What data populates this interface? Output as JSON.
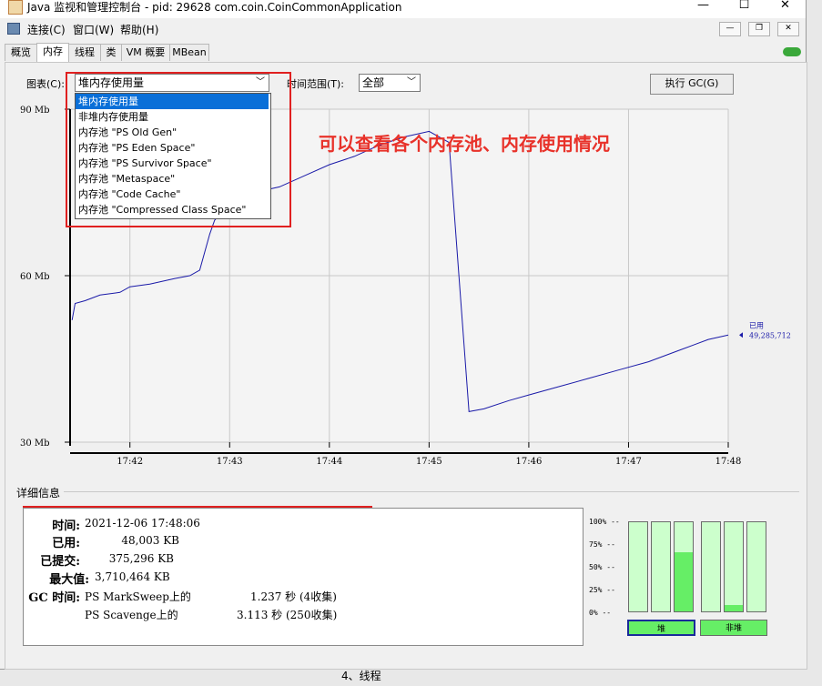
{
  "window": {
    "title": "Java 监视和管理控制台 - pid: 29628 com.coin.CoinCommonApplication",
    "minimize_icon": "minimize-icon",
    "maximize_icon": "maximize-icon",
    "close_icon": "close-icon"
  },
  "menu": [
    "连接(C)",
    "窗口(W)",
    "帮助(H)"
  ],
  "tabs": [
    "概览",
    "内存",
    "线程",
    "类",
    "VM 概要",
    "MBean"
  ],
  "active_tab": "内存",
  "controls": {
    "chart_label": "图表(C):",
    "chart_value": "堆内存使用量",
    "range_label": "时间范围(T):",
    "range_value": "全部",
    "gc_button": "执行 GC(G)"
  },
  "dropdown_options": [
    "堆内存使用量",
    "非堆内存使用量",
    "内存池 \"PS Old Gen\"",
    "内存池 \"PS Eden Space\"",
    "内存池 \"PS Survivor Space\"",
    "内存池 \"Metaspace\"",
    "内存池 \"Code Cache\"",
    "内存池 \"Compressed Class Space\""
  ],
  "annotation": "可以查看各个内存池、内存使用情况",
  "chart_data": {
    "type": "line",
    "y_ticks": [
      "90 Mb",
      "60 Mb",
      "30 Mb"
    ],
    "y_tick_values": [
      90,
      60,
      30
    ],
    "ylim": [
      30,
      90
    ],
    "x_ticks": [
      "17:42",
      "17:43",
      "17:44",
      "17:45",
      "17:46",
      "17:47",
      "17:48"
    ],
    "xlim": [
      17.4,
      24.0
    ],
    "grid": true,
    "line_color": "#1a1aa8",
    "series": [
      {
        "name": "已用",
        "x": [
          17.42,
          17.45,
          17.55,
          17.7,
          17.9,
          18.0,
          18.2,
          18.45,
          18.6,
          18.7,
          18.8,
          18.85,
          18.95,
          19.1,
          19.25,
          19.5,
          19.75,
          20.0,
          20.25,
          20.5,
          20.75,
          21.0,
          21.2,
          21.4,
          21.55,
          21.8,
          22.0,
          22.3,
          22.6,
          22.9,
          23.2,
          23.5,
          23.8,
          24.0
        ],
        "y": [
          52,
          55,
          55.5,
          56.5,
          57,
          58,
          58.5,
          59.5,
          60,
          61,
          67.5,
          70,
          72,
          73.5,
          75,
          76,
          78,
          80,
          81.5,
          83.5,
          85,
          86,
          84,
          35.5,
          36,
          37.5,
          38.5,
          40,
          41.5,
          43,
          44.5,
          46.5,
          48.5,
          49.3
        ]
      }
    ],
    "current_label": "已用",
    "current_value": "49,285,712"
  },
  "details": {
    "section_title": "详细信息",
    "time_label": "时间:",
    "time_value": "2021-12-06 17:48:06",
    "used_label": "已用:",
    "used_value": "48,003 KB",
    "committed_label": "已提交:",
    "committed_value": "375,296 KB",
    "max_label": "最大值:",
    "max_value": "3,710,464 KB",
    "gc_label": "GC 时间:",
    "gc_rows": [
      {
        "name": "PS MarkSweep上的",
        "time": "1.237 秒 (4收集)"
      },
      {
        "name": "PS Scavenge上的",
        "time": "3.113 秒 (250收集)"
      }
    ]
  },
  "bars": {
    "pct_labels": [
      "100% --",
      "75% --",
      "50% --",
      "25% --",
      "0% --"
    ],
    "heap_fill": [
      0,
      0,
      0.66
    ],
    "nonheap_fill": [
      0,
      0.07,
      0
    ],
    "heap_label": "堆",
    "nonheap_label": "非堆"
  },
  "background_text": "4、线程"
}
